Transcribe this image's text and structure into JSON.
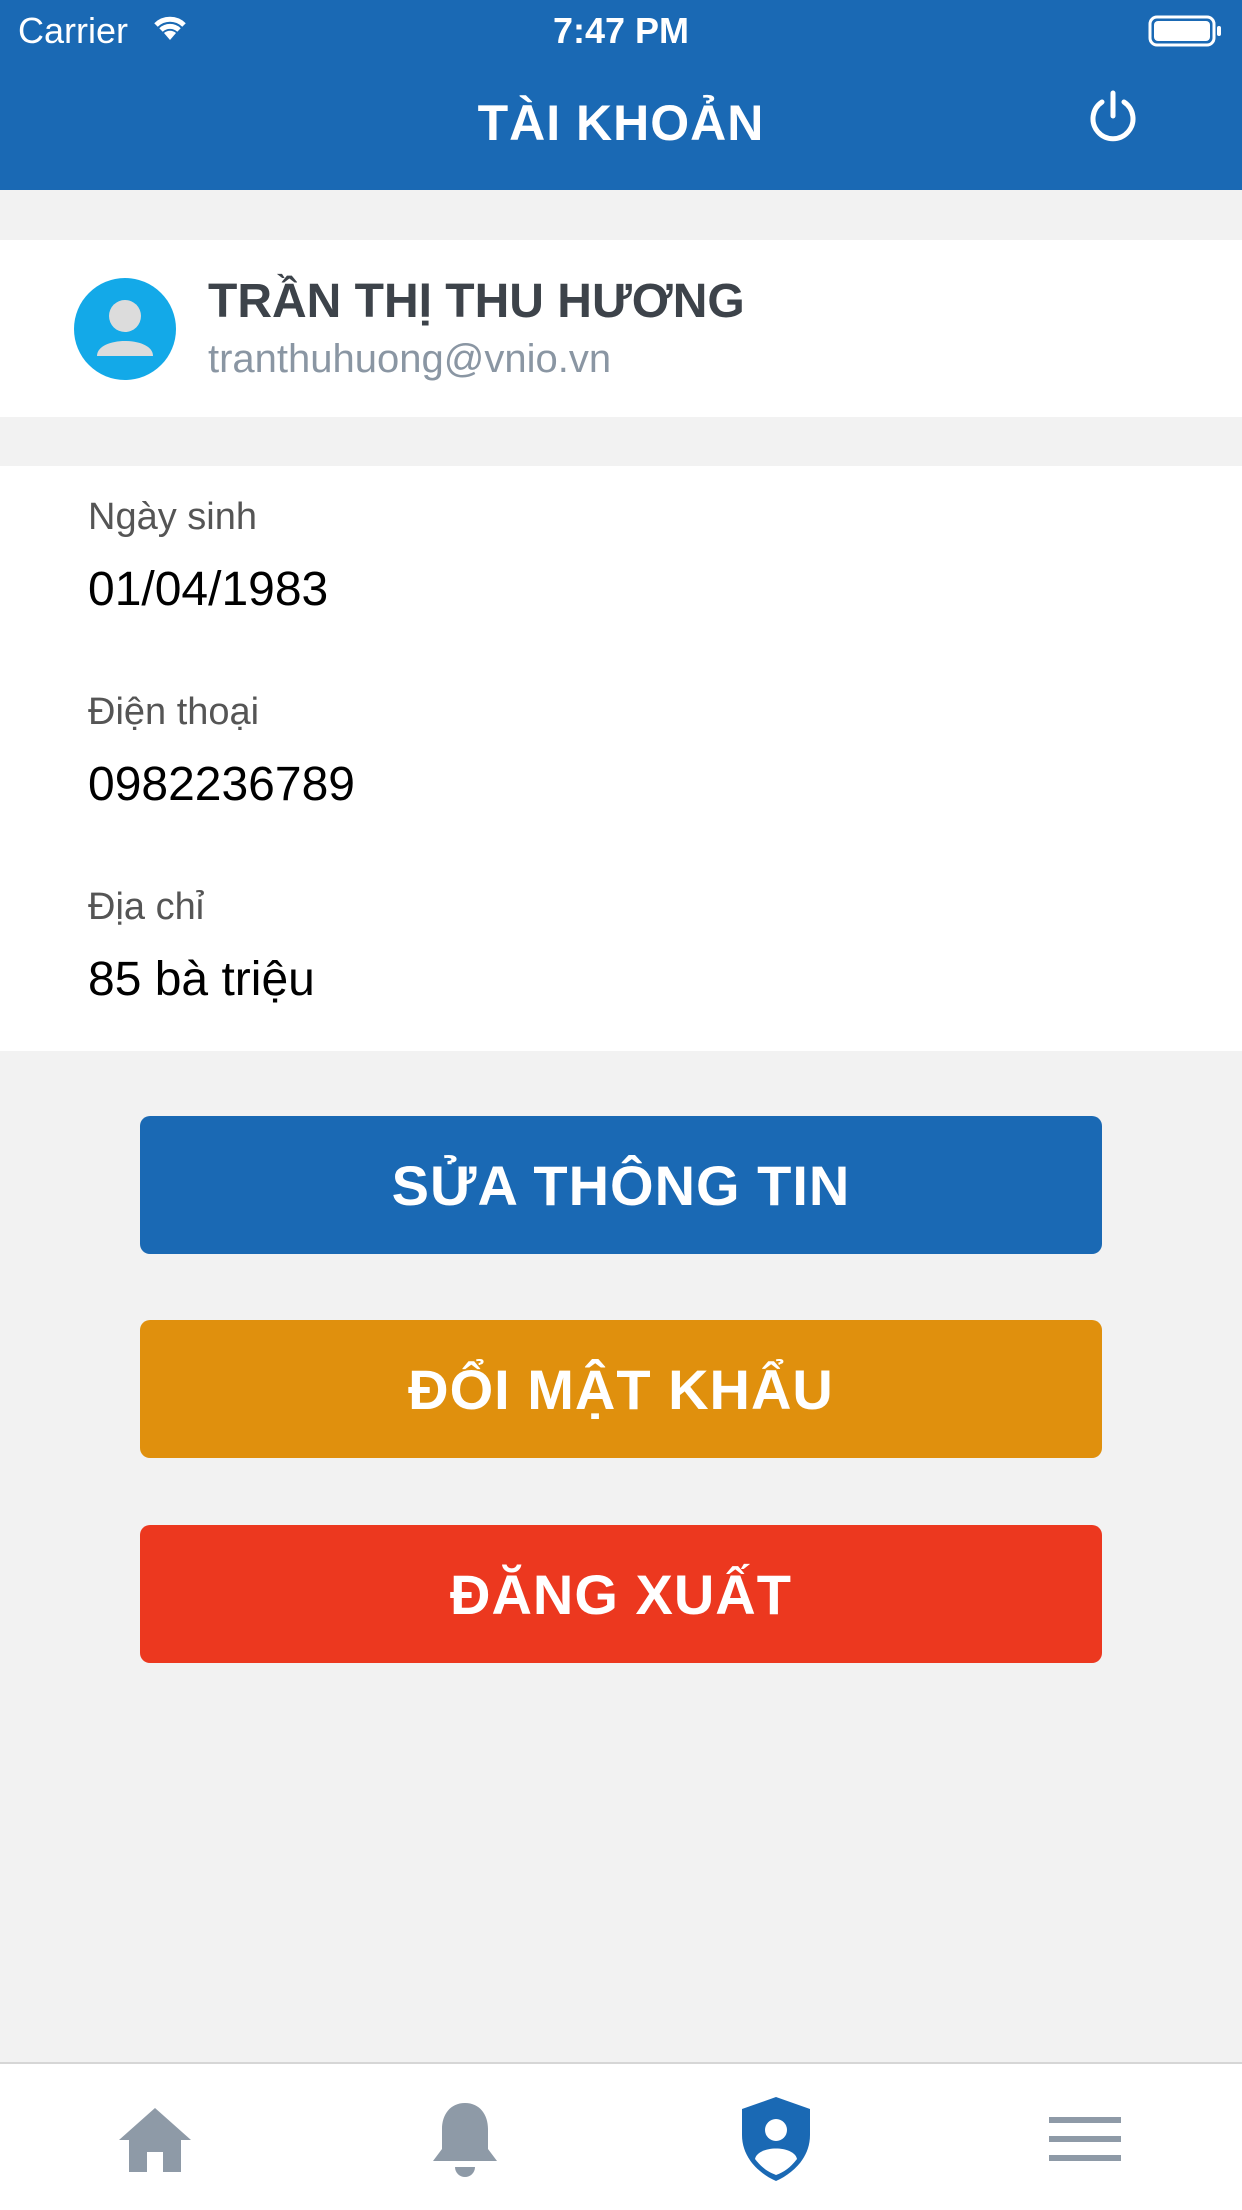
{
  "status_bar": {
    "carrier": "Carrier",
    "time": "7:47 PM"
  },
  "nav": {
    "title": "TÀI KHOẢN",
    "power_icon": "power-icon"
  },
  "profile": {
    "name": "TRẦN THỊ THU HƯƠNG",
    "email": "tranthuhuong@vnio.vn",
    "avatar_icon": "user-avatar-icon"
  },
  "info": {
    "birth_label": "Ngày sinh",
    "birth_value": "01/04/1983",
    "phone_label": "Điện thoại",
    "phone_value": "0982236789",
    "address_label": "Địa chỉ",
    "address_value": "85 bà triệu"
  },
  "buttons": {
    "edit": "SỬA THÔNG TIN",
    "change_password": "ĐỔI MẬT KHẨU",
    "logout": "ĐĂNG XUẤT"
  },
  "tabs": [
    {
      "icon": "home-icon",
      "active": false
    },
    {
      "icon": "bell-icon",
      "active": false
    },
    {
      "icon": "shield-user-icon",
      "active": true
    },
    {
      "icon": "menu-icon",
      "active": false
    }
  ],
  "colors": {
    "primary": "#1a69b4",
    "warning": "#e0900d",
    "danger": "#ec381f",
    "inactive_tab": "#8e9aa7"
  }
}
